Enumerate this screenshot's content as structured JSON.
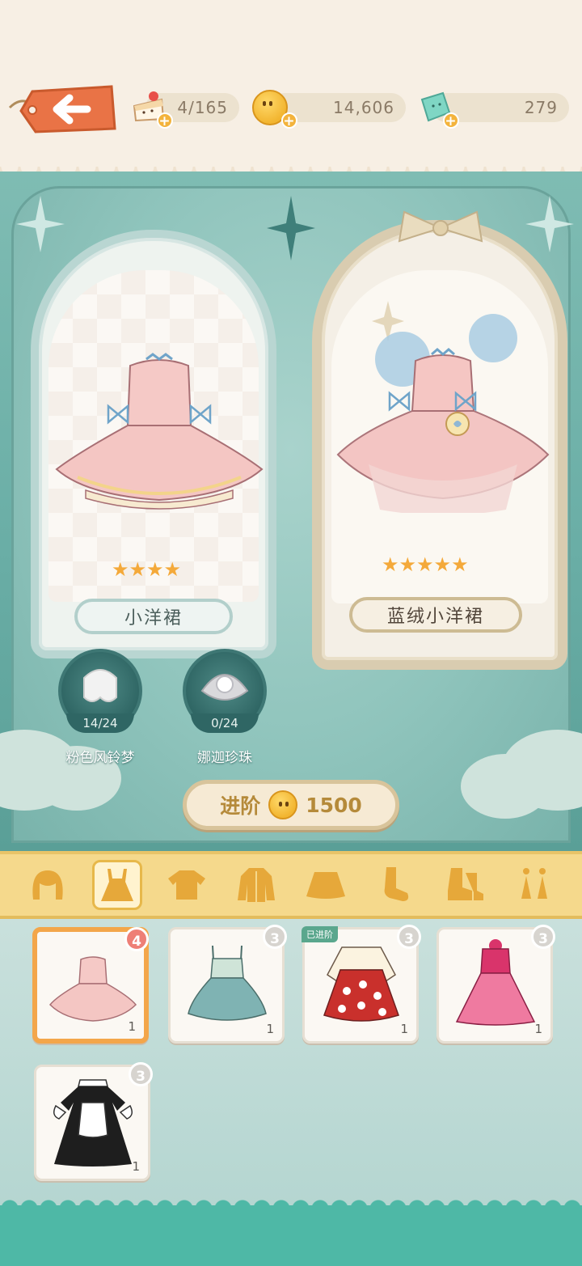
{
  "resources": {
    "stamina": "4/165",
    "coins": "14,606",
    "gems": "279"
  },
  "left_item": {
    "name": "小洋裙",
    "stars": "★★★★"
  },
  "right_item": {
    "name": "蓝绒小洋裙",
    "stars": "★★★★★"
  },
  "materials": [
    {
      "name": "粉色风铃梦",
      "count": "14/24"
    },
    {
      "name": "娜迦珍珠",
      "count": "0/24"
    }
  ],
  "advance": {
    "label": "进阶",
    "cost": "1500"
  },
  "categories": [
    {
      "icon": "hair-icon"
    },
    {
      "icon": "dress-icon",
      "active": true
    },
    {
      "icon": "top-icon"
    },
    {
      "icon": "coat-icon"
    },
    {
      "icon": "skirt-icon"
    },
    {
      "icon": "socks-icon"
    },
    {
      "icon": "shoes-icon"
    },
    {
      "icon": "accessory-icon"
    }
  ],
  "cards": [
    {
      "badge": "4",
      "qty": "1",
      "selected": true
    },
    {
      "badge": "3",
      "qty": "1"
    },
    {
      "badge": "3",
      "qty": "1",
      "tag": "已进阶"
    },
    {
      "badge": "3",
      "qty": "1"
    },
    {
      "badge": "3",
      "qty": "1"
    }
  ],
  "colors": {
    "accent": "#f3a64a",
    "scene_teal": "#7fbcb3",
    "category_bar": "#f5d98c"
  }
}
